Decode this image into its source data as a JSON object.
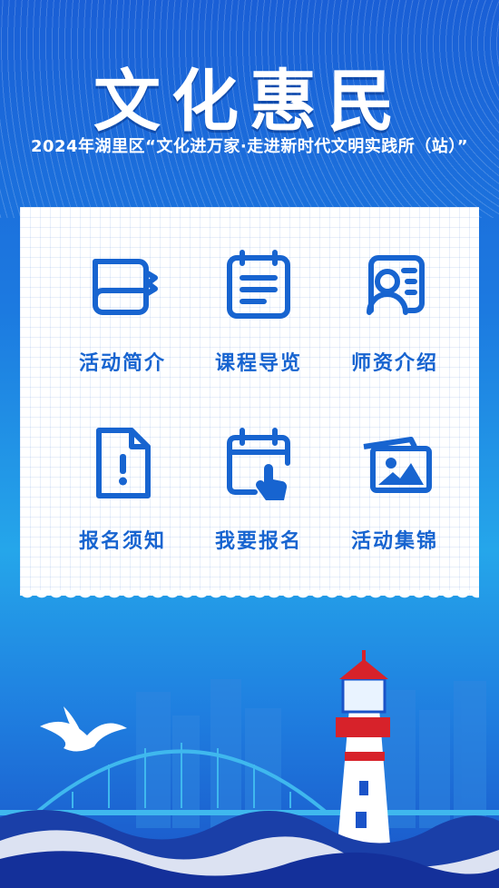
{
  "header": {
    "title": "文化惠民",
    "subtitle": "2024年湖里区“文化进万家·走进新时代文明实践所（站）”"
  },
  "menu": {
    "items": [
      {
        "label": "活动简介",
        "icon": "book-icon"
      },
      {
        "label": "课程导览",
        "icon": "calendar-list-icon"
      },
      {
        "label": "师资介绍",
        "icon": "teacher-profile-icon"
      },
      {
        "label": "报名须知",
        "icon": "notice-document-icon"
      },
      {
        "label": "我要报名",
        "icon": "calendar-click-icon"
      },
      {
        "label": "活动集锦",
        "icon": "photo-gallery-icon"
      }
    ]
  },
  "colors": {
    "accent": "#1764d0",
    "background_top": "#1a5fd6",
    "background_mid": "#25a6ea",
    "card": "#ffffff",
    "lighthouse_red": "#d7222a"
  },
  "decor": [
    "crane",
    "arch-bridge",
    "lighthouse",
    "city-skyline",
    "waves"
  ]
}
